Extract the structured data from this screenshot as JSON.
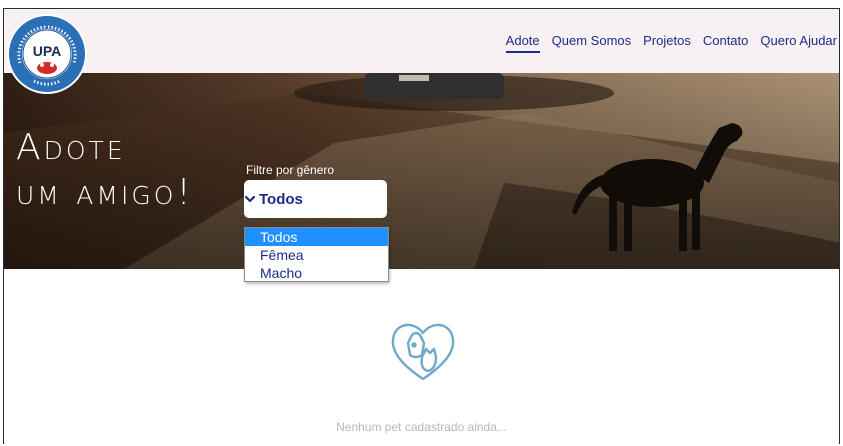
{
  "logo": {
    "abbr": "UPA",
    "ring_text": "União Protetora dos Animais",
    "city": "Lorena - SP"
  },
  "nav": {
    "items": [
      {
        "label": "Adote",
        "active": true
      },
      {
        "label": "Quem Somos"
      },
      {
        "label": "Projetos"
      },
      {
        "label": "Contato"
      },
      {
        "label": "Quero Ajudar"
      }
    ]
  },
  "hero": {
    "title_line1": "Adote",
    "title_line2": "um amigo!"
  },
  "filter": {
    "label": "Filtre por gênero",
    "selected": "Todos",
    "options": [
      "Todos",
      "Fêmea",
      "Macho"
    ]
  },
  "empty_state": {
    "message": "Nenhum pet cadastrado ainda..."
  },
  "colors": {
    "nav": "#1d2a8a",
    "header_bg": "#f8f1f4",
    "option_highlight": "#1e90ff",
    "icon": "#6fa8c8"
  }
}
